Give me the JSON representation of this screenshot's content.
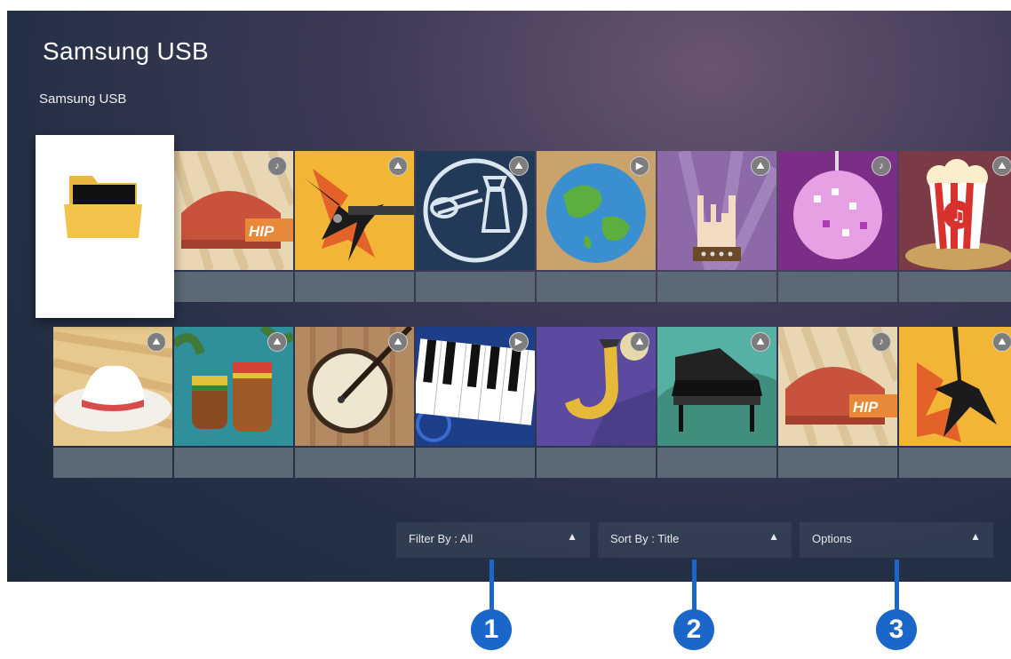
{
  "screen": {
    "title": "Samsung USB",
    "breadcrumb": "Samsung USB"
  },
  "folder_tile": {
    "icon": "folder-icon"
  },
  "tiles_row1": [
    {
      "art": "hip-hop-cap",
      "badge_icon": "music-note-icon",
      "badge": "♪"
    },
    {
      "art": "electric-guitar",
      "badge_icon": "photo-icon",
      "badge": "⛰"
    },
    {
      "art": "blues-guitarist",
      "badge_icon": "photo-icon",
      "badge": "⛰"
    },
    {
      "art": "globe",
      "badge_icon": "video-icon",
      "badge": "▶"
    },
    {
      "art": "rock-hand",
      "badge_icon": "photo-icon",
      "badge": "⛰"
    },
    {
      "art": "disco-ball",
      "badge_icon": "music-note-icon",
      "badge": "♪"
    },
    {
      "art": "popcorn",
      "badge_icon": "photo-icon",
      "badge": "⛰"
    }
  ],
  "tiles_row2": [
    {
      "art": "cowboy-hat",
      "badge_icon": "photo-icon",
      "badge": "⛰"
    },
    {
      "art": "bongo-drums",
      "badge_icon": "photo-icon",
      "badge": "⛰"
    },
    {
      "art": "banjo",
      "badge_icon": "photo-icon",
      "badge": "⛰"
    },
    {
      "art": "piano-keys",
      "badge_icon": "video-icon",
      "badge": "▶"
    },
    {
      "art": "saxophone",
      "badge_icon": "photo-icon",
      "badge": "⛰"
    },
    {
      "art": "grand-piano",
      "badge_icon": "photo-icon",
      "badge": "⛰"
    },
    {
      "art": "hip-hop-cap",
      "badge_icon": "music-note-icon",
      "badge": "♪"
    },
    {
      "art": "electric-guitar",
      "badge_icon": "photo-icon",
      "badge": "⛰"
    }
  ],
  "bottom_bar": {
    "filter_label": "Filter By : All",
    "sort_label": "Sort By : Title",
    "options_label": "Options",
    "arrow": "▲"
  },
  "callouts": [
    "1",
    "2",
    "3"
  ],
  "colors": {
    "callout": "#1a67c9",
    "folder": "#f2c24a"
  }
}
